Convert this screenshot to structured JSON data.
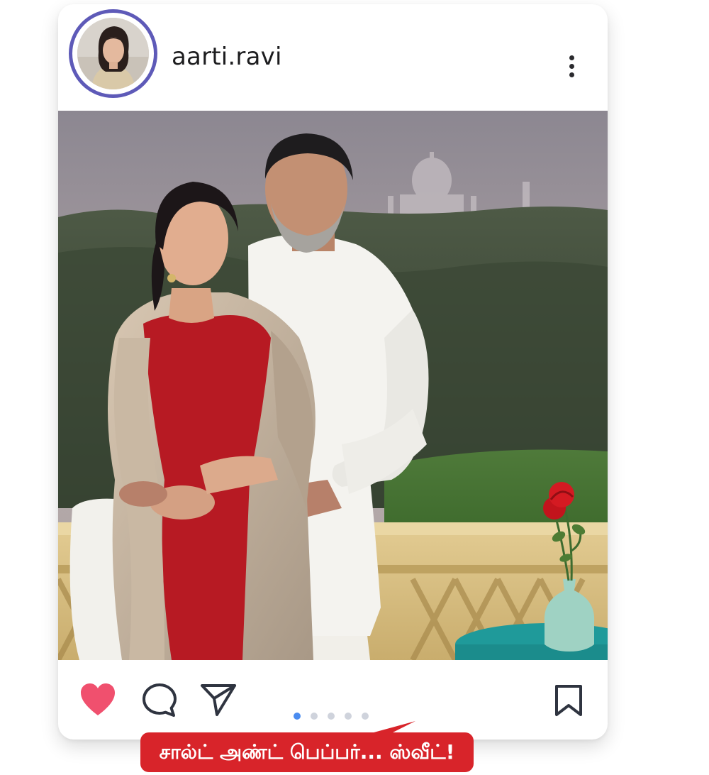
{
  "post": {
    "username": "aarti.ravi"
  },
  "actions": {
    "like_icon": "heart-icon",
    "comment_icon": "comment-icon",
    "share_icon": "send-icon",
    "save_icon": "bookmark-icon",
    "more_icon": "more-vertical-icon"
  },
  "carousel": {
    "total": 5,
    "active_index": 0
  },
  "caption": {
    "text": "சால்ட் அண்ட் பெப்பர்... ஸ்வீட்!"
  },
  "colors": {
    "avatar_ring": "#5e5ab8",
    "like": "#f0506e",
    "caption_bg": "#d8242a",
    "active_dot": "#4a8cf0",
    "inactive_dot": "#cfd3dc"
  }
}
